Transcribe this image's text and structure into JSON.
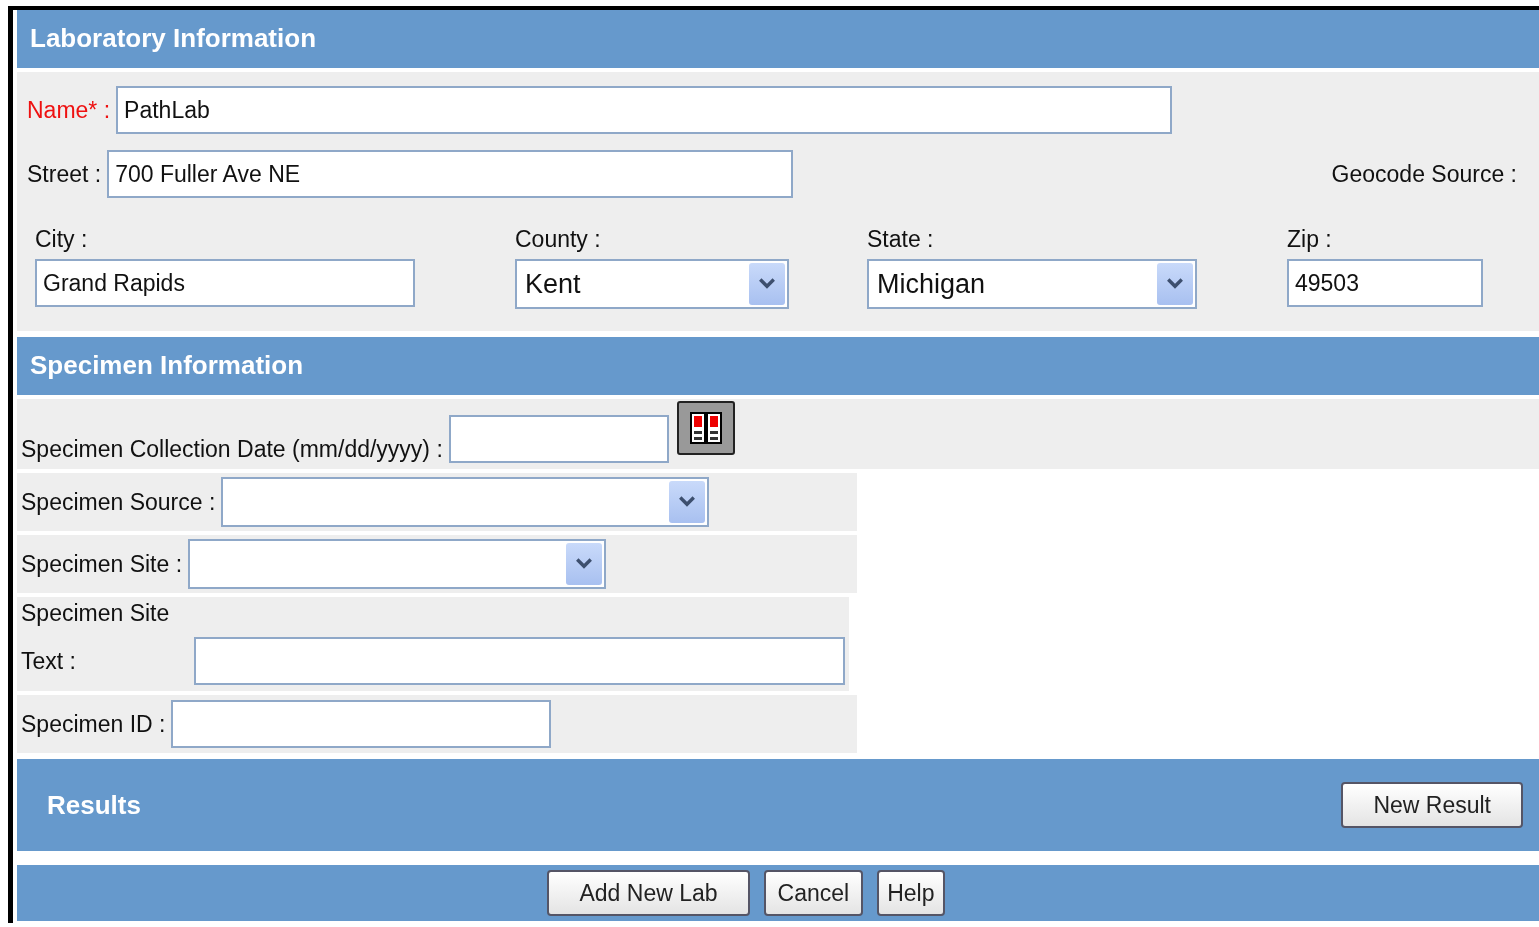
{
  "laboratory": {
    "title": "Laboratory Information",
    "name": {
      "label": "Name* :",
      "required": true,
      "value": "PathLab"
    },
    "street": {
      "label": "Street :",
      "value": "700 Fuller Ave NE"
    },
    "geocode_source": {
      "label": "Geocode Source :"
    },
    "address": [
      {
        "label": "City :",
        "kind": "text",
        "value": "Grand Rapids"
      },
      {
        "label": "County :",
        "kind": "select",
        "value": "Kent"
      },
      {
        "label": "State :",
        "kind": "select",
        "value": "Michigan"
      },
      {
        "label": "Zip :",
        "kind": "text",
        "value": "49503"
      }
    ]
  },
  "specimen": {
    "title": "Specimen Information",
    "rows": [
      {
        "label": "Specimen Collection Date (mm/dd/yyyy) :",
        "kind": "date",
        "value": ""
      },
      {
        "label": "Specimen Source :",
        "kind": "select",
        "value": ""
      },
      {
        "label": "Specimen Site :",
        "kind": "select",
        "value": ""
      },
      {
        "label": "Specimen Site Text :",
        "kind": "wrapped",
        "value": ""
      },
      {
        "label": "Specimen ID :",
        "kind": "text",
        "value": ""
      }
    ]
  },
  "results": {
    "title": "Results",
    "button": "New Result"
  },
  "buttons": [
    "Add New Lab",
    "Cancel",
    "Help"
  ]
}
